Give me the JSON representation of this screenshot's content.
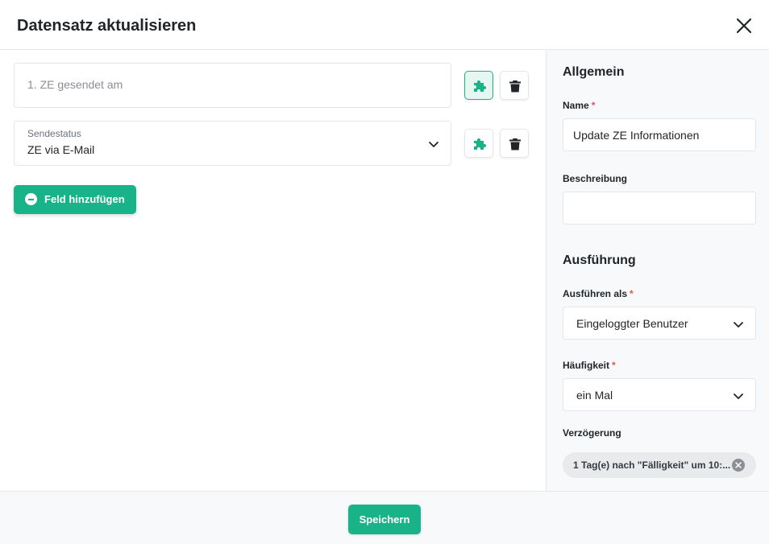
{
  "dialog": {
    "title": "Datensatz aktualisieren",
    "close_icon": "close-icon"
  },
  "fields": [
    {
      "placeholder": "1. ZE gesendet am",
      "value": ""
    },
    {
      "label": "Sendestatus",
      "value": "ZE via E-Mail"
    }
  ],
  "icons": {
    "puzzle": "puzzle-icon",
    "trash": "trash-icon",
    "chevron": "chevron-down-icon"
  },
  "add_field_button": {
    "label": "Feld hinzufügen",
    "icon": "plus-circle-icon"
  },
  "sidebar": {
    "general": {
      "heading": "Allgemein",
      "name_label": "Name",
      "name_value": "Update ZE Informationen",
      "description_label": "Beschreibung",
      "description_value": ""
    },
    "execution": {
      "heading": "Ausführung",
      "run_as_label": "Ausführen als",
      "run_as_value": "Eingeloggter Benutzer",
      "frequency_label": "Häufigkeit",
      "frequency_value": "ein Mal",
      "delay_label": "Verzögerung",
      "delay_value": "1 Tag(e) nach \"Fälligkeit\" um 10:..."
    },
    "required_mark": "*"
  },
  "footer": {
    "save_label": "Speichern"
  },
  "colors": {
    "accent": "#19b38a",
    "required": "#e55353"
  }
}
